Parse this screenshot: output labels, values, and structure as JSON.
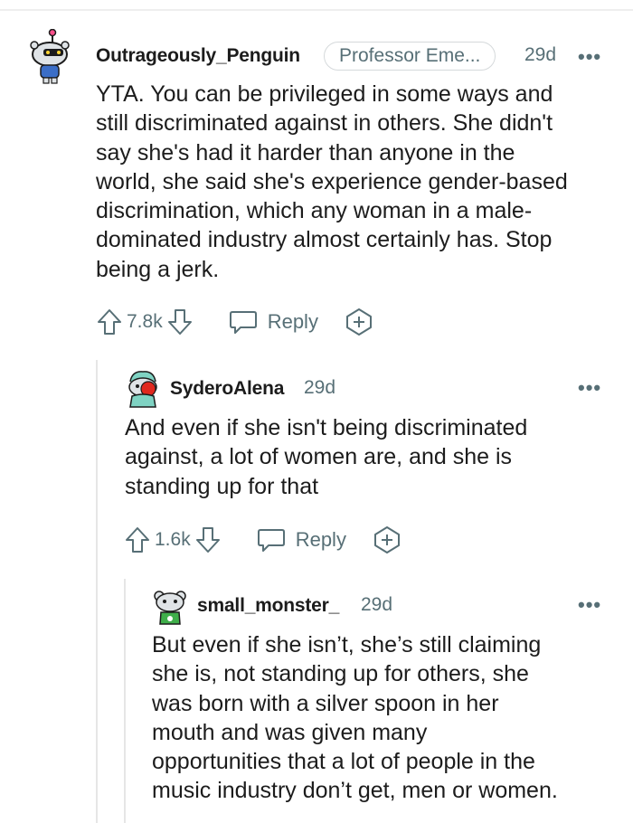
{
  "comments": [
    {
      "username": "Outrageously_Penguin",
      "flair": "Professor Eme...",
      "time": "29d",
      "more": "•••",
      "lines": [
        "YTA. You can be privileged in some ways and",
        "still discriminated against in others. She didn't",
        "say she's had it harder than anyone in the",
        "world, she said she's experience gender-based",
        "discrimination, which any woman in a male-",
        "dominated industry almost certainly has. Stop",
        "being a jerk."
      ],
      "votes": "7.8k",
      "reply": "Reply"
    },
    {
      "username": "SyderoAlena",
      "time": "29d",
      "more": "•••",
      "lines": [
        "And even if she isn't being discriminated",
        "against, a lot of women are, and she is",
        "standing up for that"
      ],
      "votes": "1.6k",
      "reply": "Reply"
    },
    {
      "username": "small_monster_",
      "time": "29d",
      "more": "•••",
      "lines": [
        "But even if she isn’t, she’s still claiming",
        "she is, not standing up for others, she",
        "was born with a silver spoon in her",
        "mouth and was given many",
        "opportunities that a lot of people in the",
        "music industry don’t get, men or women."
      ]
    }
  ],
  "icons": {
    "upvote": "arrow-up-icon",
    "downvote": "arrow-down-icon",
    "reply": "speech-bubble-icon",
    "award": "award-plus-icon",
    "more": "ellipsis-icon"
  },
  "colors": {
    "meta": "#576f76",
    "text": "#1c1c1c",
    "thread": "#e6e6e6"
  }
}
